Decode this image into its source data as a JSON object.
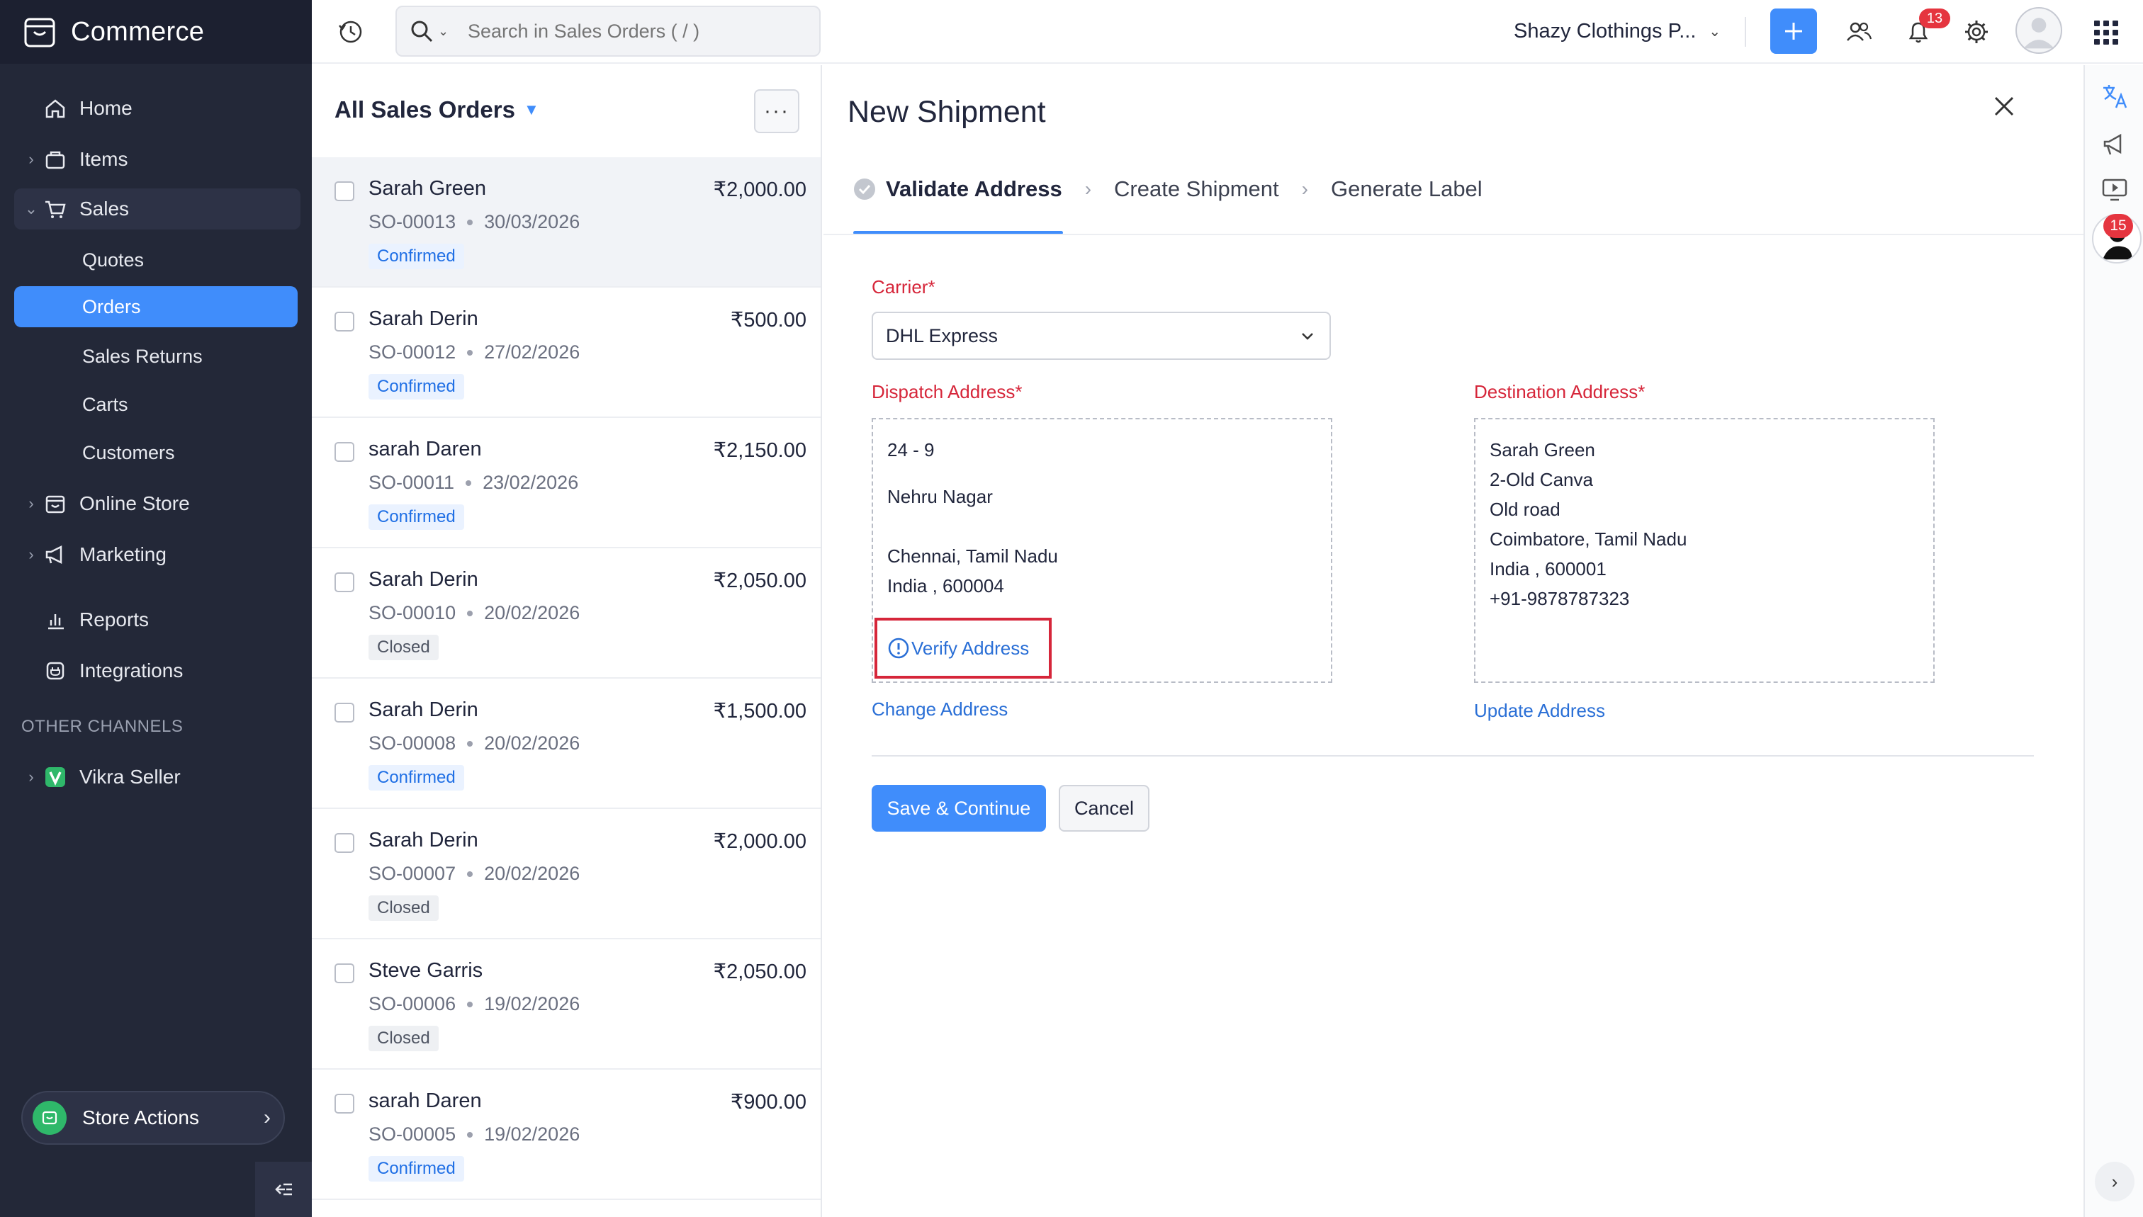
{
  "app": {
    "name": "Commerce"
  },
  "sidebar": {
    "items": [
      {
        "label": "Home"
      },
      {
        "label": "Items"
      },
      {
        "label": "Sales"
      },
      {
        "label": "Online Store"
      },
      {
        "label": "Marketing"
      },
      {
        "label": "Reports"
      },
      {
        "label": "Integrations"
      }
    ],
    "sales_sub": [
      {
        "label": "Quotes"
      },
      {
        "label": "Orders"
      },
      {
        "label": "Sales Returns"
      },
      {
        "label": "Carts"
      },
      {
        "label": "Customers"
      }
    ],
    "section_label": "OTHER CHANNELS",
    "channels": [
      {
        "label": "Vikra Seller"
      }
    ],
    "store_actions": "Store Actions"
  },
  "topbar": {
    "search_placeholder": "Search in Sales Orders ( / )",
    "org_name": "Shazy Clothings P...",
    "notification_count": "13"
  },
  "list": {
    "title": "All Sales Orders",
    "more": "···",
    "orders": [
      {
        "name": "Sarah Green",
        "amount": "₹2,000.00",
        "number": "SO-00013",
        "date": "30/03/2026",
        "status": "Confirmed"
      },
      {
        "name": "Sarah Derin",
        "amount": "₹500.00",
        "number": "SO-00012",
        "date": "27/02/2026",
        "status": "Confirmed"
      },
      {
        "name": "sarah Daren",
        "amount": "₹2,150.00",
        "number": "SO-00011",
        "date": "23/02/2026",
        "status": "Confirmed"
      },
      {
        "name": "Sarah Derin",
        "amount": "₹2,050.00",
        "number": "SO-00010",
        "date": "20/02/2026",
        "status": "Closed"
      },
      {
        "name": "Sarah Derin",
        "amount": "₹1,500.00",
        "number": "SO-00008",
        "date": "20/02/2026",
        "status": "Confirmed"
      },
      {
        "name": "Sarah Derin",
        "amount": "₹2,000.00",
        "number": "SO-00007",
        "date": "20/02/2026",
        "status": "Closed"
      },
      {
        "name": "Steve Garris",
        "amount": "₹2,050.00",
        "number": "SO-00006",
        "date": "19/02/2026",
        "status": "Closed"
      },
      {
        "name": "sarah Daren",
        "amount": "₹900.00",
        "number": "SO-00005",
        "date": "19/02/2026",
        "status": "Confirmed"
      }
    ]
  },
  "shipment": {
    "title": "New Shipment",
    "steps": [
      {
        "label": "Validate Address"
      },
      {
        "label": "Create Shipment"
      },
      {
        "label": "Generate Label"
      }
    ],
    "carrier_label": "Carrier*",
    "carrier_value": "DHL Express",
    "dispatch_label": "Dispatch Address*",
    "dispatch_lines": [
      "24 - 9",
      "",
      "Nehru Nagar",
      "",
      "Chennai, Tamil Nadu",
      "India , 600004"
    ],
    "verify_label": "Verify Address",
    "change_address": "Change Address",
    "destination_label": "Destination Address*",
    "destination_lines": [
      "Sarah Green",
      "2-Old Canva",
      "Old road",
      "Coimbatore, Tamil Nadu",
      "India , 600001",
      "+91-9878787323"
    ],
    "update_address": "Update Address",
    "save_label": "Save & Continue",
    "cancel_label": "Cancel"
  },
  "rail": {
    "badge": "15"
  },
  "colors": {
    "accent": "#408dfb",
    "sidebar_bg": "#232838",
    "required_red": "#d6263a",
    "link_blue": "#2a6fd6",
    "badge_red": "#e5353f"
  }
}
